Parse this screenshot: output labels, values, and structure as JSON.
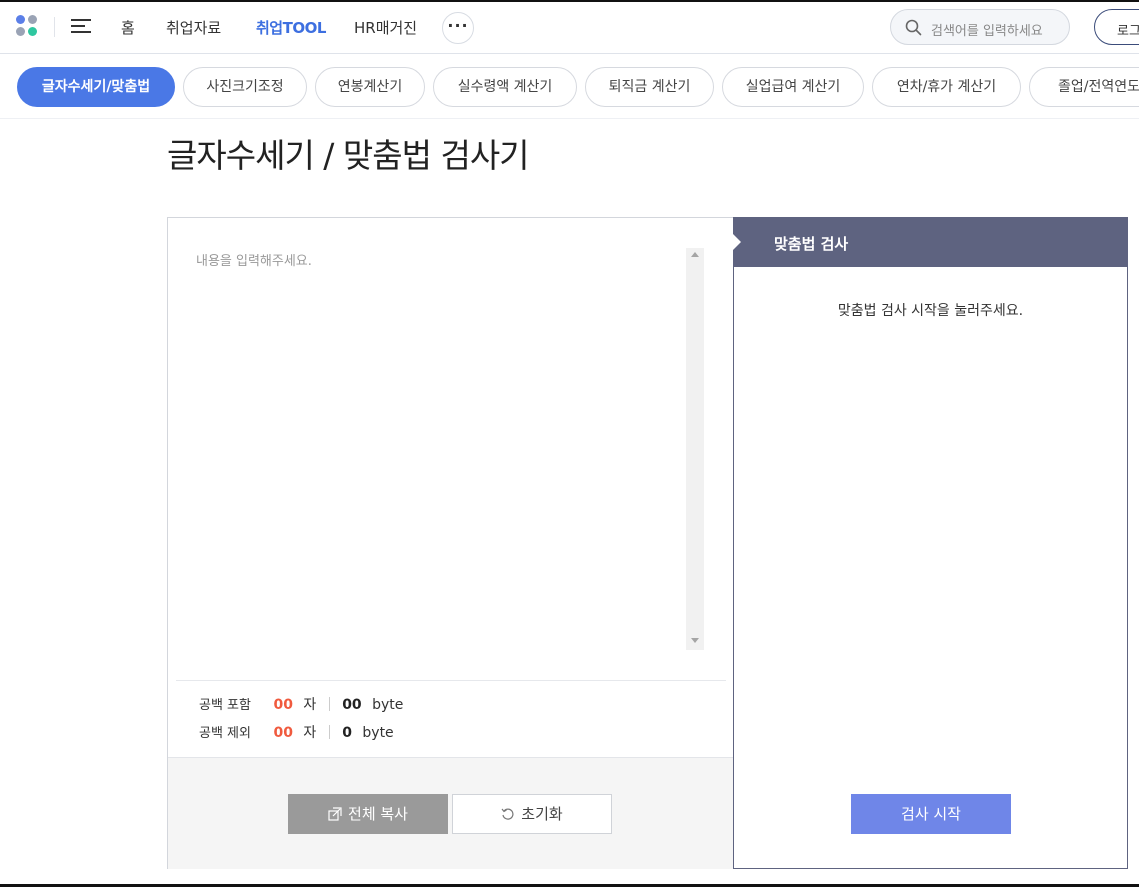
{
  "nav": {
    "home": "홈",
    "job_data": "취업자료",
    "job_tool": "취업TOOL",
    "hr_magazine": "HR매거진",
    "more": "···",
    "search_placeholder": "검색어를 입력하세요",
    "login": "로그인"
  },
  "tabs": [
    {
      "label": "글자수세기/맞춤법",
      "active": true
    },
    {
      "label": "사진크기조정"
    },
    {
      "label": "연봉계산기"
    },
    {
      "label": "실수령액 계산기"
    },
    {
      "label": "퇴직금 계산기"
    },
    {
      "label": "실업급여 계산기"
    },
    {
      "label": "연차/휴가 계산기"
    },
    {
      "label": "졸업/전역연도"
    }
  ],
  "page": {
    "title": "글자수세기 / 맞춤법 검사기"
  },
  "editor": {
    "placeholder": "내용을 입력해주세요."
  },
  "counts": {
    "with_space_label": "공백 포함",
    "with_space_chars": "00",
    "with_space_bytes": "00",
    "without_space_label": "공백 제외",
    "without_space_chars": "00",
    "without_space_bytes": "0",
    "char_unit": "자",
    "byte_unit": "byte"
  },
  "buttons": {
    "copy_all": "전체 복사",
    "reset": "초기화",
    "start_check": "검사 시작"
  },
  "spell_panel": {
    "title": "맞춤법 검사",
    "message": "맞춤법 검사 시작을 눌러주세요."
  },
  "colors": {
    "accent": "#4a78e6",
    "count_highlight": "#f05a3e",
    "panel_header": "#5e6380",
    "start_button": "#6f86e8"
  }
}
